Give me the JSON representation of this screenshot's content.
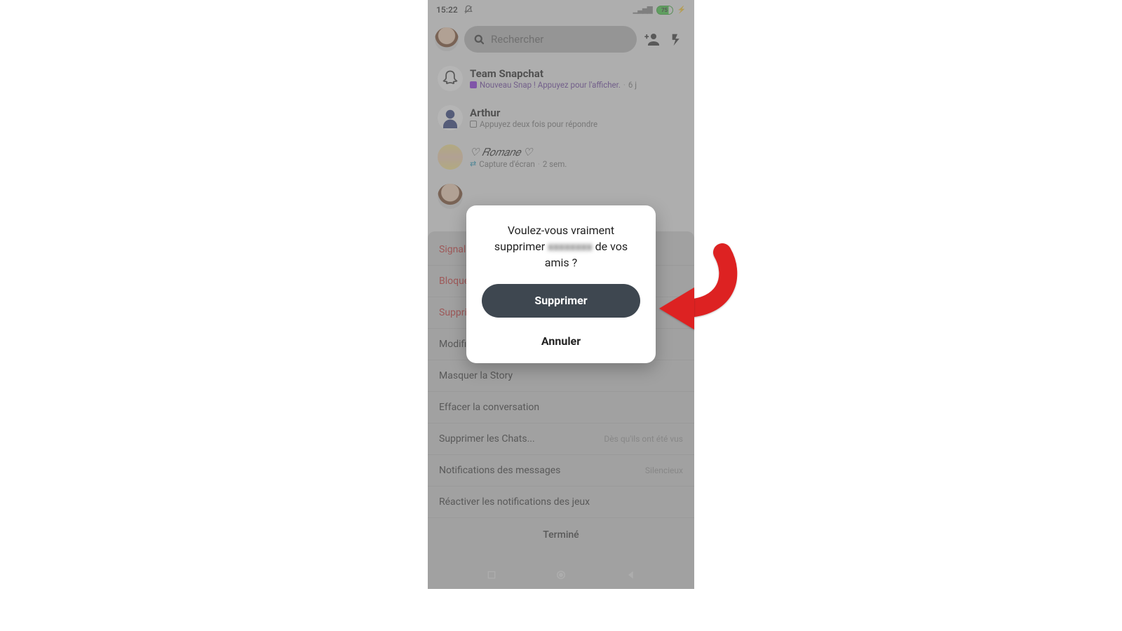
{
  "statusbar": {
    "time": "15:22",
    "battery_pct": "75"
  },
  "header": {
    "search_placeholder": "Rechercher"
  },
  "chats": [
    {
      "name": "Team Snapchat",
      "subtitle": "Nouveau Snap ! Appuyez pour l'afficher.",
      "time": "6 j",
      "avatar": "ghost",
      "indicator": "purple-fill"
    },
    {
      "name": "Arthur",
      "subtitle": "Appuyez deux fois pour répondre",
      "time": "",
      "avatar": "blue-sil",
      "indicator": "outline"
    },
    {
      "name": "♡ 𝑅𝑜𝑚𝑎𝑛𝑒 ♡",
      "subtitle": "Capture d'écran",
      "time": "2 sem.",
      "avatar": "romane",
      "indicator": "arrows"
    },
    {
      "name": "",
      "subtitle": "",
      "time": "",
      "avatar": "me2",
      "indicator": ""
    }
  ],
  "action_sheet": {
    "rows": [
      {
        "label": "Signaler",
        "danger": true
      },
      {
        "label": "Bloquer",
        "danger": true
      },
      {
        "label": "Supprimer",
        "danger": true
      },
      {
        "label": "Modifier le nom",
        "danger": false
      },
      {
        "label": "Masquer la Story",
        "danger": false
      },
      {
        "label": "Effacer la conversation",
        "danger": false
      },
      {
        "label": "Supprimer les Chats...",
        "danger": false,
        "hint": "Dès qu'ils ont été vus"
      },
      {
        "label": "Notifications des messages",
        "danger": false,
        "hint": "Silencieux"
      },
      {
        "label": "Réactiver les notifications des jeux",
        "danger": false
      }
    ],
    "done": "Terminé"
  },
  "dialog": {
    "title_pre": "Voulez-vous vraiment supprimer ",
    "title_blur": "xxxxxxxx",
    "title_post": " de vos amis ?",
    "confirm": "Supprimer",
    "cancel": "Annuler"
  }
}
